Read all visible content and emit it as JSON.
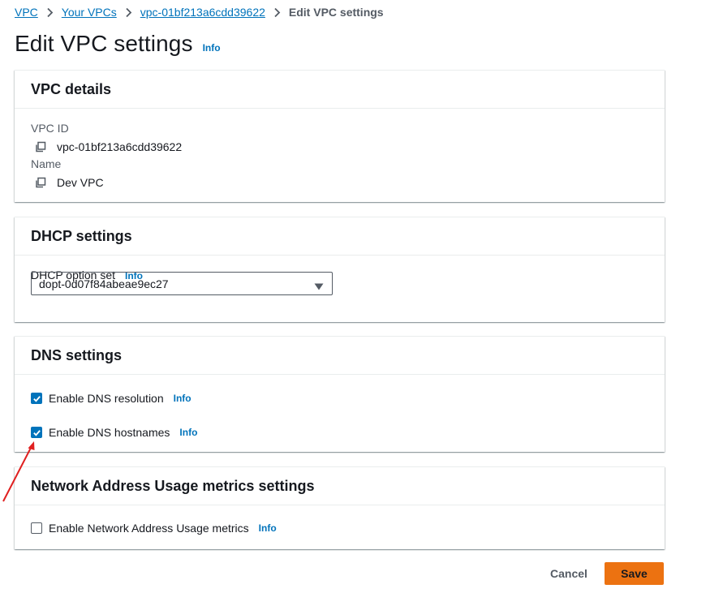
{
  "breadcrumb": {
    "items": [
      "VPC",
      "Your VPCs",
      "vpc-01bf213a6cdd39622"
    ],
    "current": "Edit VPC settings"
  },
  "page": {
    "title": "Edit VPC settings",
    "info": "Info"
  },
  "vpc_details": {
    "title": "VPC details",
    "vpc_id_label": "VPC ID",
    "vpc_id_value": "vpc-01bf213a6cdd39622",
    "name_label": "Name",
    "name_value": "Dev VPC"
  },
  "dhcp": {
    "title": "DHCP settings",
    "option_set_label": "DHCP option set",
    "info": "Info",
    "selected_value": "dopt-0d07f84abeae9ec27"
  },
  "dns": {
    "title": "DNS settings",
    "resolution_label": "Enable DNS resolution",
    "resolution_checked": true,
    "hostnames_label": "Enable DNS hostnames",
    "hostnames_checked": true,
    "info": "Info"
  },
  "nau": {
    "title": "Network Address Usage metrics settings",
    "metrics_label": "Enable Network Address Usage metrics",
    "metrics_checked": false,
    "info": "Info"
  },
  "actions": {
    "cancel": "Cancel",
    "save": "Save"
  },
  "colors": {
    "link": "#0073bb",
    "primary": "#ec7211",
    "annotation_arrow": "#e02020"
  },
  "icons": [
    "chevron-right-icon",
    "copy-icon",
    "caret-down-icon",
    "check-icon",
    "arrow-annotation"
  ]
}
